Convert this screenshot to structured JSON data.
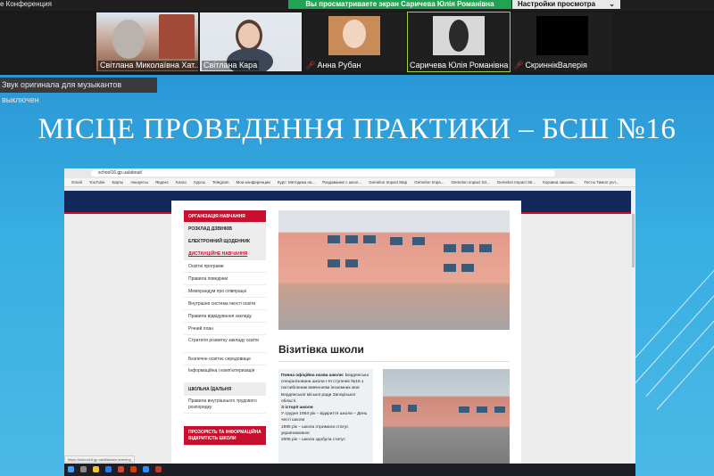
{
  "topbar": {
    "app_title": "е Конференция",
    "share_banner": "Вы просматриваете экран Саричева Юлія Романівна",
    "view_options": "Настройки просмотра"
  },
  "participants": [
    {
      "name": "Світлана Миколаївна Хат...",
      "muted": false
    },
    {
      "name": "Світлана Кара",
      "muted": false
    },
    {
      "name": "Анна Рубан",
      "muted": true
    },
    {
      "name": "Саричева Юлія Романівна",
      "muted": false
    },
    {
      "name": "СкриннікВалерія",
      "muted": true
    }
  ],
  "notice": "Звук оригинала для музыкантов выключен",
  "slide": {
    "title": "МІСЦЕ ПРОВЕДЕННЯ ПРАКТИКИ – БСШ №16"
  },
  "browser": {
    "url": "school16.gp.ua/about/",
    "bookmarks": [
      "Gmail",
      "YouTube",
      "Карты",
      "Аккаунты",
      "Яндекс",
      "Класс",
      "Курсы",
      "Telegram",
      "Мои конференции",
      "Курс: Методика на...",
      "Раздавание с школ...",
      "Gemelon Impact Map",
      "Gemelon Impa...",
      "Gemelon impact Str...",
      "Gemelon Impact Str...",
      "Корзина заказов...",
      "Тесты Тимол усл..."
    ],
    "menu": [
      {
        "label": "ОРГАНІЗАЦІЯ НАВЧАННЯ",
        "style": "red"
      },
      {
        "label": "РОЗКЛАД ДЗВІНКІВ",
        "style": "bold"
      },
      {
        "label": "ЕЛЕКТРОННИЙ ЩОДЕННИК",
        "style": "bold"
      },
      {
        "label": "ДИСТАНЦІЙНЕ НАВЧАННЯ",
        "style": "active"
      },
      {
        "label": "Освітні програми",
        "style": "sub"
      },
      {
        "label": "Правила поведінки",
        "style": "sub"
      },
      {
        "label": "Меморандум про співпрацю",
        "style": "sub"
      },
      {
        "label": "Внутрішня система якості освіти",
        "style": "sub"
      },
      {
        "label": "Правила відвідування закладу",
        "style": "sub"
      },
      {
        "label": "Річний план",
        "style": "sub"
      },
      {
        "label": "Стратегія розвитку закладу освіти",
        "style": "sub-tall"
      },
      {
        "label": "Безпечне освітнє середовище",
        "style": "sub"
      },
      {
        "label": "Інформаційна і комп'ютеризація",
        "style": "sub-tall"
      },
      {
        "label": "ШКІЛЬНА ЇДАЛЬНЯ",
        "style": "bold"
      },
      {
        "label": "Правила внутрішнього трудового розпорядку",
        "style": "sub-tall"
      },
      {
        "label": "ПРОЗОРІСТЬ ТА ІНФОРМАЦІЙНА ВІДКРИТІСТЬ ШКОЛИ",
        "style": "red-tall"
      }
    ],
    "heading": "Візитівка школи",
    "info": {
      "full_name_label": "Повна офіційна назва школи:",
      "full_name": "Бердянська спеціалізована школа І-ІІІ ступенів №16 з поглибленим вивченням іноземних мов Бердянської міської ради Запорізької області.",
      "history_label": "З історії школи",
      "history": [
        "У грудня 1954 рік – відкриття школи – День честі школи",
        "1995 рік – школа отримала статус україномовної",
        "2005 рік – школа здобула статус"
      ]
    },
    "status_url": "https://school16.gp.ua/distance-learning"
  }
}
